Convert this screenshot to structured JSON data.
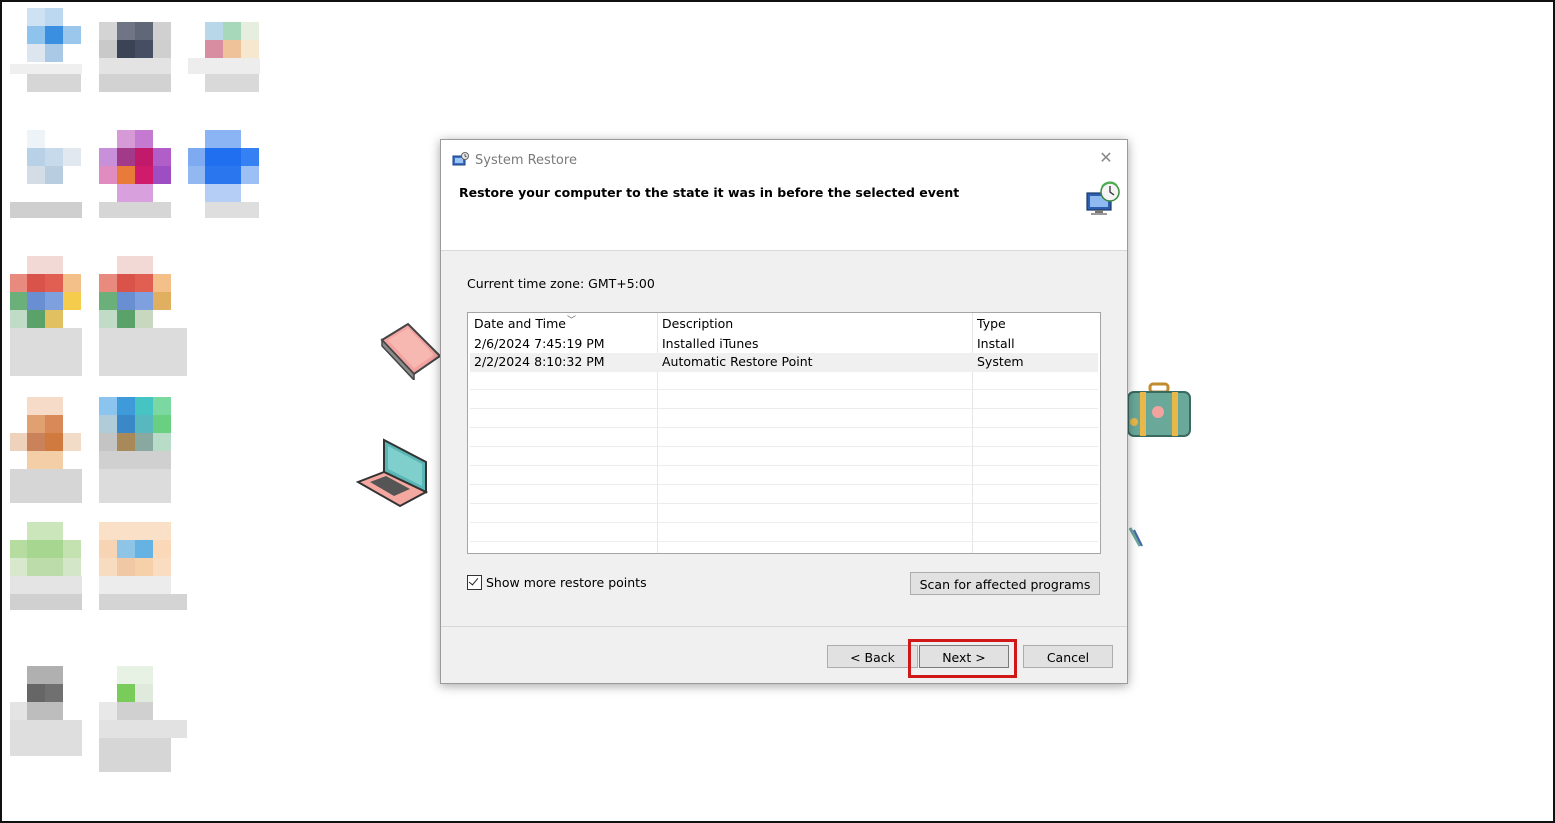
{
  "dialog": {
    "title": "System Restore",
    "heading": "Restore your computer to the state it was in before the selected event",
    "timezone_label": "Current time zone: GMT+5:00",
    "columns": [
      "Date and Time",
      "Description",
      "Type"
    ],
    "rows": [
      {
        "date": "2/6/2024 7:45:19 PM",
        "description": "Installed iTunes",
        "type": "Install"
      },
      {
        "date": "2/2/2024 8:10:32 PM",
        "description": "Automatic Restore Point",
        "type": "System"
      }
    ],
    "show_more_label": "Show more restore points",
    "show_more_checked": true,
    "scan_button": "Scan for affected programs",
    "back_button": "< Back",
    "next_button": "Next >",
    "cancel_button": "Cancel"
  },
  "colors": {
    "highlight": "#d01818",
    "dialog_bg": "#f0f0f0",
    "button_bg": "#e1e1e1"
  }
}
